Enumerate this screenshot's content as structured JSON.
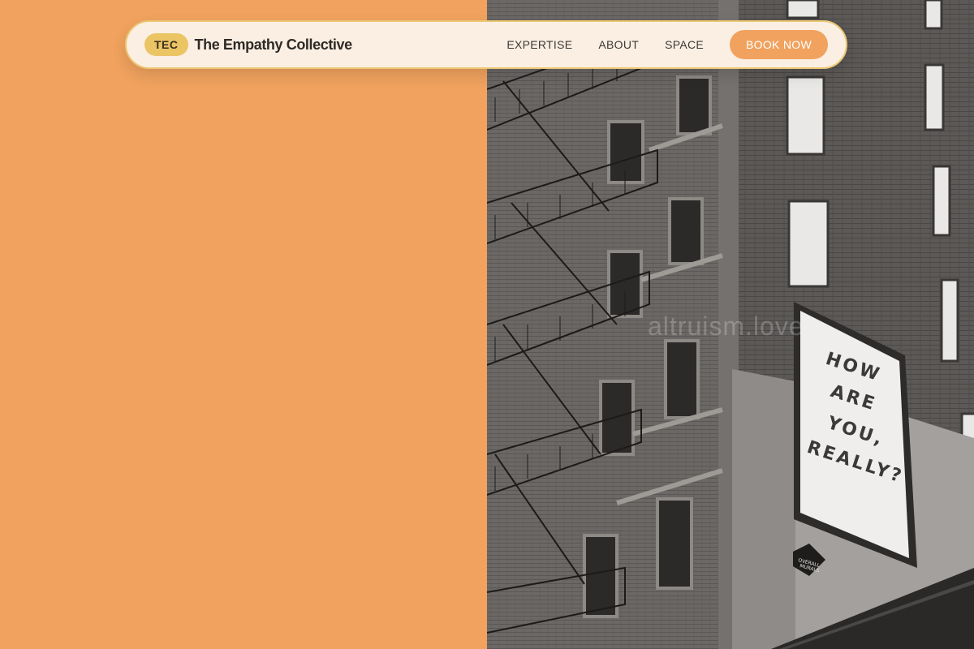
{
  "brand": {
    "badge": "TEC",
    "name": "The Empathy Collective"
  },
  "nav": {
    "links": [
      "EXPERTISE",
      "ABOUT",
      "SPACE"
    ],
    "cta": "BOOK NOW"
  },
  "hero": {
    "mural_lines": [
      "HOW",
      "ARE",
      "YOU,",
      "REALLY?"
    ],
    "sign_lines": [
      "OVERALL",
      "MURALS"
    ],
    "watermark": "altruism.love"
  },
  "colors": {
    "accent": "#f0a25e",
    "badge": "#ebc464",
    "nav_bg": "#fbefe3",
    "nav_border": "#ebc774"
  }
}
